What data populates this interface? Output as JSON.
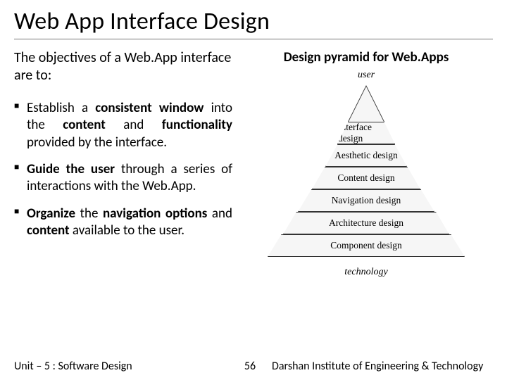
{
  "title": "Web App Interface Design",
  "intro": "The objectives of a Web.App interface are to:",
  "bullets": [
    "Establish a <b>consistent window</b> into the <b>content</b> and <b>functionality</b> provided by the interface.",
    "<b>Guide the user</b> through a series of interactions with the Web.App.",
    "<b>Organize</b> the <b>navigation options</b> and <b>content</b> available to the user."
  ],
  "figure": {
    "title": "Design pyramid for Web.Apps",
    "apex_label": "user",
    "base_label": "technology",
    "layers": [
      "Interface design",
      "Aesthetic design",
      "Content design",
      "Navigation design",
      "Architecture design",
      "Component design"
    ]
  },
  "footer": {
    "unit": "Unit – 5 : Software Design",
    "page": "56",
    "org": "Darshan Institute of Engineering & Technology"
  }
}
